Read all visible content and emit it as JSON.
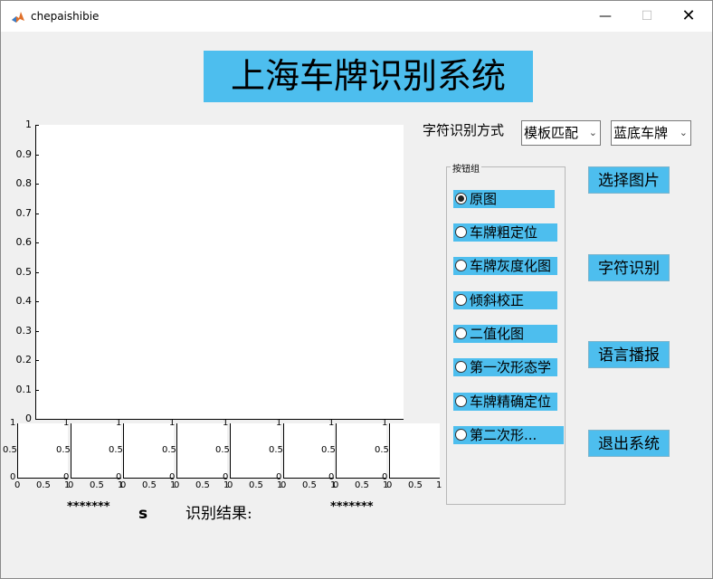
{
  "window": {
    "title": "chepaishibie",
    "minimize": "—",
    "maximize": "☐",
    "close": "✕"
  },
  "banner": "上海车牌识别系统",
  "main_axes": {
    "yticks": [
      "1",
      "0.9",
      "0.8",
      "0.7",
      "0.6",
      "0.5",
      "0.4",
      "0.3",
      "0.2",
      "0.1",
      "0"
    ]
  },
  "small_axes": {
    "ytop": "1",
    "ymid": "0.5",
    "ybottom": "0",
    "x0": "0",
    "xmid": "0.5",
    "x1": "1"
  },
  "left_placeholder": "*******",
  "s_label": "s",
  "result_label": "识别结果:",
  "result_value": "*******",
  "method_label": "字符识别方式",
  "method_select": "模板匹配",
  "plate_select": "蓝底车牌",
  "group_title": "按钮组",
  "radios": [
    "原图",
    "车牌粗定位",
    "车牌灰度化图",
    "倾斜校正",
    "二值化图",
    "第一次形态学",
    "车牌精确定位",
    "第二次形..."
  ],
  "buttons": {
    "select_image": "选择图片",
    "recognize": "字符识别",
    "speech": "语言播报",
    "exit": "退出系统"
  },
  "colors": {
    "accent": "#4dbeee",
    "background": "#f0f0f0"
  }
}
